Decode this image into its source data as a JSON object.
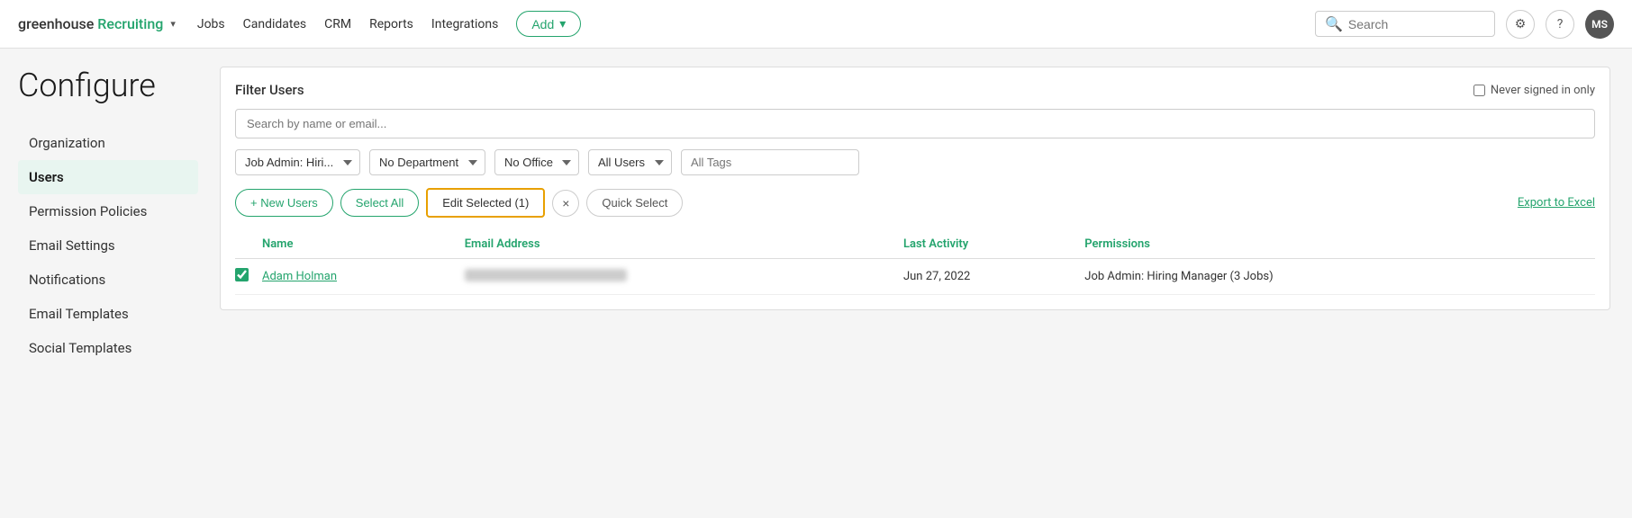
{
  "brand": {
    "name_black": "greenhouse",
    "name_green": "Recruiting",
    "chevron": "▾"
  },
  "nav": {
    "links": [
      "Jobs",
      "Candidates",
      "CRM",
      "Reports",
      "Integrations"
    ],
    "add_label": "Add",
    "add_chevron": "▾"
  },
  "search": {
    "placeholder": "Search"
  },
  "icons": {
    "settings": "⚙",
    "help": "?",
    "avatar": "MS",
    "search": "🔍"
  },
  "page": {
    "title": "Configure"
  },
  "sidebar": {
    "items": [
      {
        "label": "Organization",
        "active": false
      },
      {
        "label": "Users",
        "active": true
      },
      {
        "label": "Permission Policies",
        "active": false
      },
      {
        "label": "Email Settings",
        "active": false
      },
      {
        "label": "Notifications",
        "active": false
      },
      {
        "label": "Email Templates",
        "active": false
      },
      {
        "label": "Social Templates",
        "active": false
      }
    ]
  },
  "filter": {
    "title": "Filter Users",
    "search_placeholder": "Search by name or email...",
    "never_signed_label": "Never signed in only",
    "dropdowns": {
      "job_admin": "Job Admin: Hiri...",
      "department": "No Department",
      "office": "No Office",
      "user_type": "All Users",
      "tags_placeholder": "All Tags"
    }
  },
  "actions": {
    "new_users": "+ New Users",
    "select_all": "Select All",
    "edit_selected": "Edit Selected (1)",
    "close": "×",
    "quick_select": "Quick Select",
    "export": "Export to Excel"
  },
  "table": {
    "columns": [
      "",
      "Name",
      "Email Address",
      "Last Activity",
      "Permissions"
    ],
    "rows": [
      {
        "checked": true,
        "name": "Adam Holman",
        "email": "",
        "last_activity": "Jun 27, 2022",
        "permissions": "Job Admin: Hiring Manager (3 Jobs)"
      }
    ]
  }
}
